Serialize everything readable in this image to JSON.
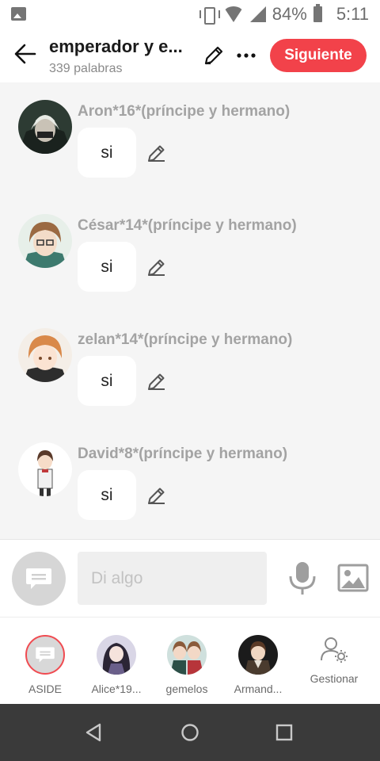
{
  "status_bar": {
    "battery_percent": "84%",
    "time": "5:11",
    "icons": [
      "image-icon",
      "vibrate-icon",
      "wifi-icon",
      "signal-icon",
      "battery-icon"
    ]
  },
  "header": {
    "title": "emperador y e...",
    "subtitle": "339 palabras",
    "next_label": "Siguiente",
    "accent_color": "#f2424a"
  },
  "messages": [
    {
      "character": "Aron*16*(príncipe y hermano)",
      "text": "si"
    },
    {
      "character": "César*14*(príncipe y hermano)",
      "text": "si"
    },
    {
      "character": "zelan*14*(príncipe y hermano)",
      "text": "si"
    },
    {
      "character": "David*8*(príncipe y hermano)",
      "text": "si"
    }
  ],
  "input": {
    "placeholder": "Di algo",
    "value": ""
  },
  "character_tray": [
    {
      "label": "ASIDE",
      "selected": true
    },
    {
      "label": "Alice*19..."
    },
    {
      "label": "gemelos"
    },
    {
      "label": "Armand..."
    },
    {
      "label": "Gestionar"
    }
  ]
}
